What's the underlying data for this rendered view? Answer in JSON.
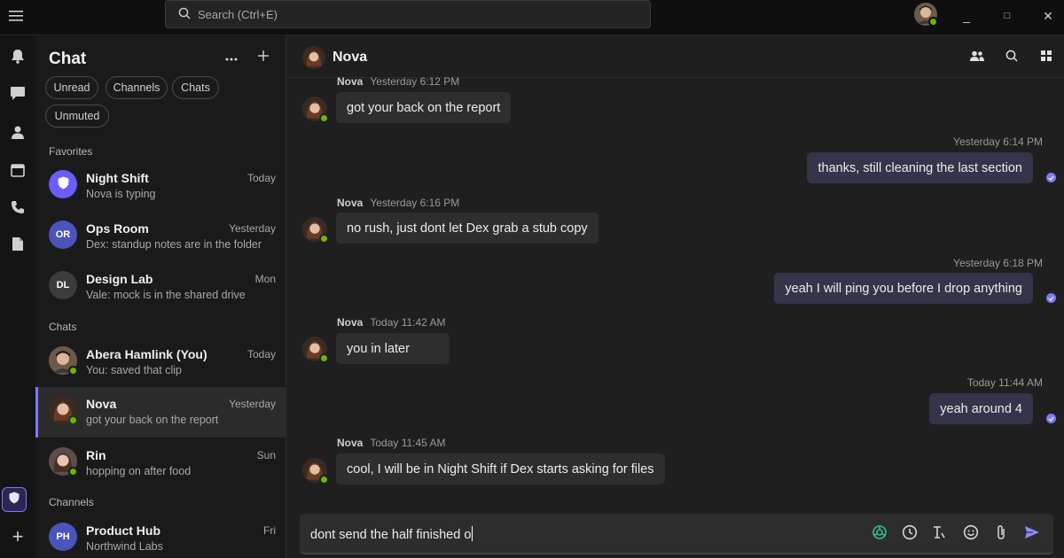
{
  "titlebar": {
    "search_placeholder": "Search (Ctrl+E)",
    "minimize": "_",
    "maximize": "□",
    "close": "✕"
  },
  "colors": {
    "accent": "#7b79ff",
    "online": "#6bb700",
    "outgoing_bubble": "#34344a",
    "incoming_bubble": "#2e2e2e"
  },
  "rail": {
    "items": [
      "bell-icon",
      "chat-icon",
      "people-icon",
      "calendar-icon",
      "phone-icon",
      "file-icon"
    ],
    "add_label": "+"
  },
  "chatlist": {
    "title": "Chat",
    "filters": [
      "Unread",
      "Channels",
      "Chats",
      "Unmuted"
    ],
    "sections": {
      "favorites": "Favorites",
      "chats": "Chats",
      "channels": "Channels"
    },
    "favorites": [
      {
        "name": "Night Shift",
        "preview": "Nova is typing",
        "time": "Today",
        "avatar": "shield-icon"
      },
      {
        "name": "Ops Room",
        "preview": "Dex: standup notes are in the folder",
        "time": "Yesterday",
        "initials": "OR"
      },
      {
        "name": "Design Lab",
        "preview": "Vale: mock is in the shared drive",
        "time": "Mon",
        "initials": "DL"
      }
    ],
    "chats": [
      {
        "name": "Abera Hamlink (You)",
        "preview": "You: saved that clip",
        "time": "Today"
      },
      {
        "name": "Nova",
        "preview": "got your back on the report",
        "time": "Yesterday"
      },
      {
        "name": "Rin",
        "preview": "hopping on after food",
        "time": "Sun"
      }
    ],
    "channels": [
      {
        "name": "Product Hub",
        "preview": "Northwind Labs",
        "time": "Fri",
        "initials": "PH"
      }
    ]
  },
  "conversation": {
    "name": "Nova",
    "messages": [
      {
        "sender": "Nova",
        "time": "Yesterday 6:12 PM",
        "text": "got your back on the report"
      },
      {
        "time": "Yesterday 6:14 PM",
        "text": "thanks, still cleaning the last section"
      },
      {
        "sender": "Nova",
        "time": "Yesterday 6:16 PM",
        "text": "no rush, just dont let Dex grab a stub copy"
      },
      {
        "time": "Yesterday 6:18 PM",
        "text": "yeah I will ping you before I drop anything"
      },
      {
        "sender": "Nova",
        "time": "Today 11:42 AM",
        "text": "you in later"
      },
      {
        "time": "Today 11:44 AM",
        "text": "yeah around 4"
      },
      {
        "sender": "Nova",
        "time": "Today 11:45 AM",
        "text": "cool, I will be in Night Shift if Dex starts asking for files"
      }
    ],
    "composer_text": "dont send the half finished o"
  }
}
